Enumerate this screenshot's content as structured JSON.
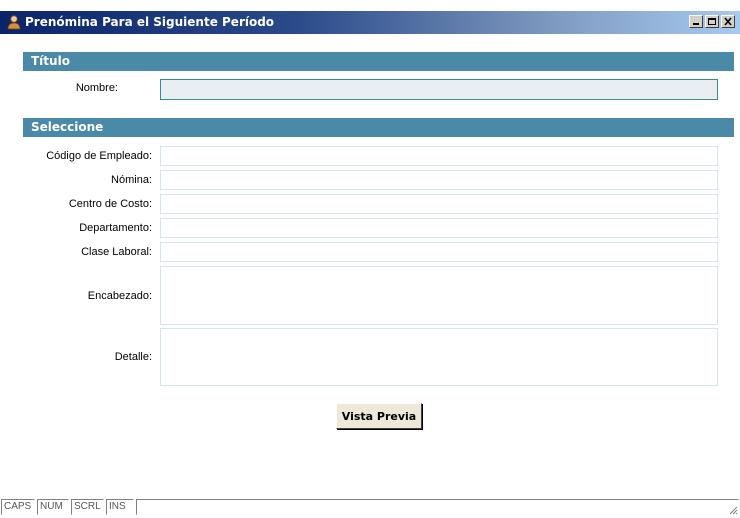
{
  "window": {
    "title": "Prenómina Para el Siguiente Período",
    "icon": "user-icon",
    "controls": [
      "minimize-icon",
      "maximize-icon",
      "close-icon"
    ]
  },
  "sections": {
    "titulo": {
      "header": "Título"
    },
    "seleccione": {
      "header": "Seleccione"
    }
  },
  "fields": {
    "nombre": {
      "label": "Nombre:",
      "value": ""
    },
    "codigo_empleado": {
      "label": "Código de Empleado:",
      "value": ""
    },
    "nomina": {
      "label": "Nómina:",
      "value": ""
    },
    "centro_costo": {
      "label": "Centro de Costo:",
      "value": ""
    },
    "departamento": {
      "label": "Departamento:",
      "value": ""
    },
    "clase_laboral": {
      "label": "Clase Laboral:",
      "value": ""
    },
    "encabezado": {
      "label": "Encabezado:",
      "value": ""
    },
    "detalle": {
      "label": "Detalle:",
      "value": ""
    }
  },
  "buttons": {
    "preview": "Vista Previa"
  },
  "statusbar": {
    "items": [
      "CAPS",
      "NUM",
      "SCRL",
      "INS"
    ],
    "message": ""
  },
  "colors": {
    "titlebar_start": "#0a246a",
    "titlebar_end": "#a6caf0",
    "section_header": "#4a8aa8",
    "focused_border": "#3a8a8a",
    "field_border": "#d6e4ec"
  }
}
